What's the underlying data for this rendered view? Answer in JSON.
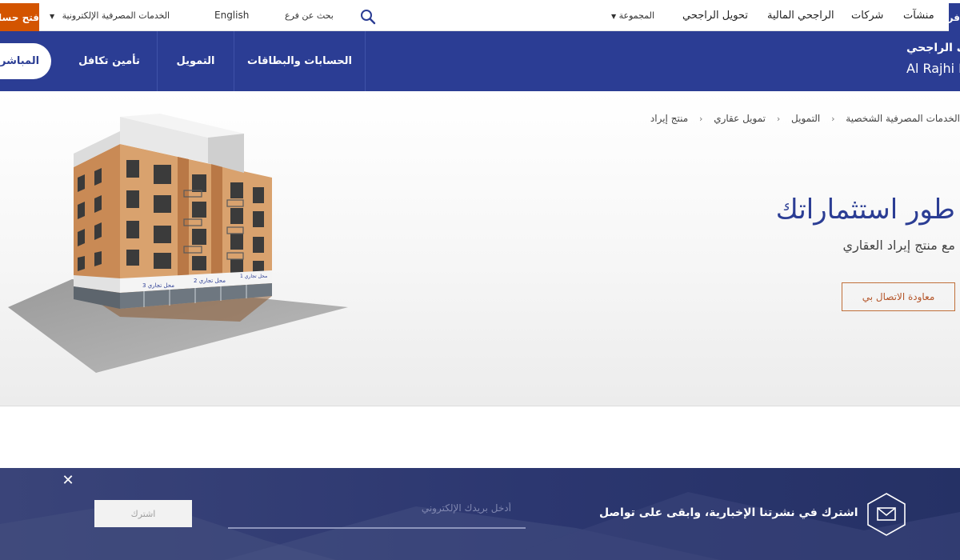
{
  "topbar": {
    "open_account_label": "فتح حساب",
    "eservices_label": "الخدمات المصرفية الإلكترونية",
    "language_label": "English",
    "branch_search_label": "بحث عن فرع",
    "search_icon": "search-icon",
    "group_label": "المجموعة",
    "links": [
      "تحويل الراجحي",
      "الراجحي المالية",
      "شركات",
      "منشآت"
    ],
    "edge_label": "فردي"
  },
  "nav": {
    "direct_label": "المباشر",
    "items": [
      "تأمين تكافل",
      "التمويل",
      "الحسابات والبطاقات"
    ],
    "brand_ar": "مصرف الراجحي",
    "brand_en": "Al Rajhi Bank"
  },
  "breadcrumb": [
    "الخدمات المصرفية الشخصية",
    "التمويل",
    "تمويل عقاري",
    "منتج إيراد"
  ],
  "hero": {
    "title": "طور استثماراتك",
    "subtitle": "مع منتج إيراد العقاري",
    "cta_label": "معاودة الاتصال بي",
    "shop_signs": [
      "محل تجاري 3",
      "محل تجاري 2",
      "محل تجاري 1"
    ]
  },
  "newsletter": {
    "text": "اشترك في نشرتنا الإخبارية، وابقى على تواصل",
    "email_placeholder": "أدخل بريدك الإلكتروني",
    "email_value": "",
    "subscribe_label": "اشترك",
    "close_icon": "close-icon",
    "mail_icon": "mail-icon"
  },
  "colors": {
    "brand_blue": "#2b3d94",
    "accent_orange": "#d35400",
    "newsletter_bg": "#2c3770"
  }
}
